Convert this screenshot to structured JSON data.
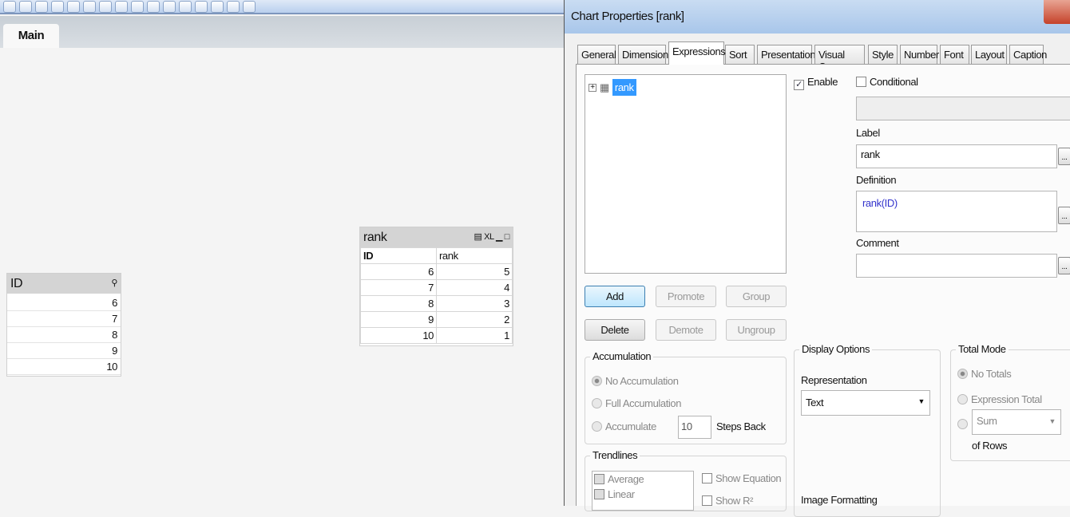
{
  "toolbar": {
    "icons": [
      "new-sheet-icon",
      "listbox-icon",
      "sigma-icon",
      "table-icon",
      "bar-chart-icon",
      "button-icon",
      "v-icon",
      "window-icon",
      "text-icon",
      "arrow-icon",
      "search-icon",
      "star-icon",
      "zoom-icon",
      "layout-icon",
      "chart-wizard-icon",
      "align-icon"
    ]
  },
  "sheet_tabs": [
    {
      "label": "Main"
    }
  ],
  "listbox": {
    "title": "ID",
    "values": [
      "6",
      "7",
      "8",
      "9",
      "10"
    ]
  },
  "straight_table": {
    "title": "rank",
    "xl_label": "XL",
    "columns": [
      "ID",
      "rank"
    ],
    "rows": [
      [
        "6",
        "5"
      ],
      [
        "7",
        "4"
      ],
      [
        "8",
        "3"
      ],
      [
        "9",
        "2"
      ],
      [
        "10",
        "1"
      ]
    ]
  },
  "dialog": {
    "title": "Chart Properties [rank]",
    "tabs": [
      "General",
      "Dimensions",
      "Expressions",
      "Sort",
      "Presentation",
      "Visual Cues",
      "Style",
      "Number",
      "Font",
      "Layout",
      "Caption"
    ],
    "active_tab": "Expressions",
    "expressions": [
      {
        "label": "rank"
      }
    ],
    "enable_label": "Enable",
    "enable_checked": true,
    "conditional_label": "Conditional",
    "conditional_checked": false,
    "label_caption": "Label",
    "label_value": "rank",
    "definition_caption": "Definition",
    "definition_func": "rank",
    "definition_args": "(ID)",
    "comment_caption": "Comment",
    "comment_value": "",
    "dots": "...",
    "buttons": {
      "add": "Add",
      "promote": "Promote",
      "group": "Group",
      "delete": "Delete",
      "demote": "Demote",
      "ungroup": "Ungroup"
    },
    "accumulation": {
      "title": "Accumulation",
      "no": "No Accumulation",
      "full": "Full Accumulation",
      "acc": "Accumulate",
      "steps": "10",
      "steps_label": "Steps Back",
      "selected": "No Accumulation"
    },
    "trendlines": {
      "title": "Trendlines",
      "items": [
        "Average",
        "Linear"
      ],
      "show_equation": "Show Equation",
      "show_r2": "Show R²"
    },
    "display_options": {
      "title": "Display Options",
      "representation_label": "Representation",
      "representation_value": "Text",
      "image_formatting": "Image Formatting"
    },
    "total_mode": {
      "title": "Total Mode",
      "no_totals": "No Totals",
      "expression_total": "Expression Total",
      "sum": "Sum",
      "of_rows": "of Rows",
      "selected": "No Totals"
    },
    "accent": "#3399ff"
  }
}
